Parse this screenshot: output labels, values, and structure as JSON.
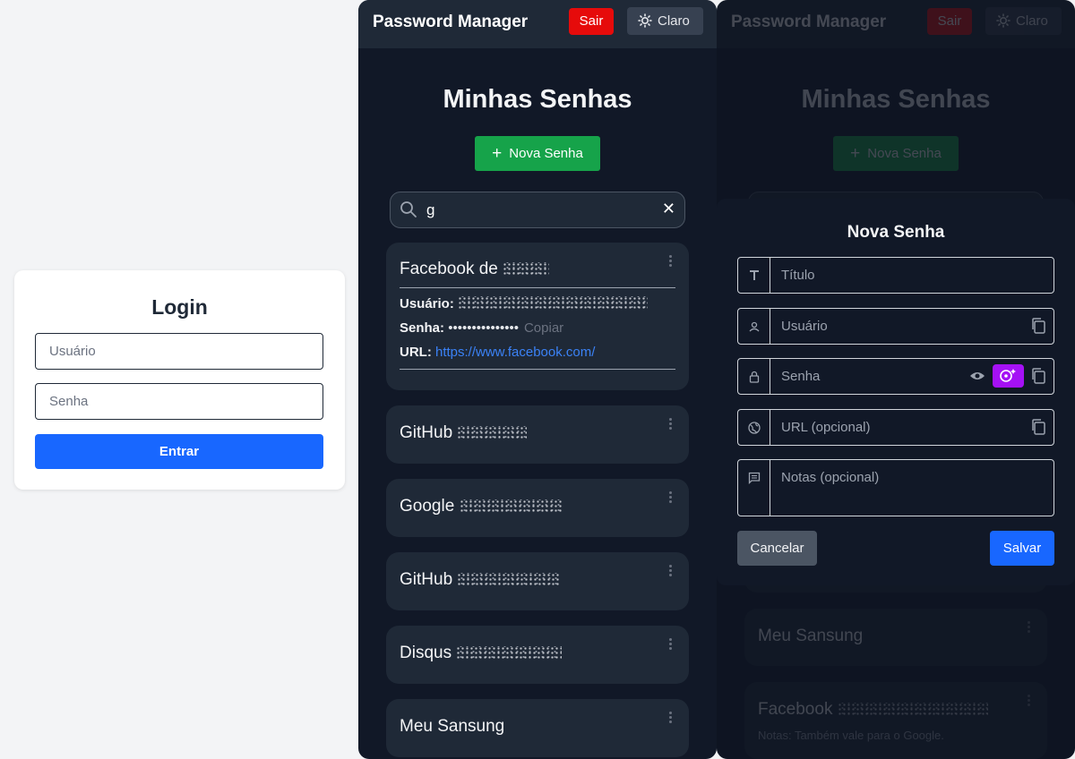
{
  "login": {
    "title": "Login",
    "username_placeholder": "Usuário",
    "password_placeholder": "Senha",
    "submit_label": "Entrar"
  },
  "header": {
    "title": "Password Manager",
    "logout_label": "Sair",
    "theme_label": "Claro"
  },
  "main": {
    "title": "Minhas Senhas",
    "new_button_label": "Nova Senha",
    "search_value": "g",
    "clear_icon": "✕"
  },
  "cards": [
    {
      "title": "Facebook de",
      "expanded": true,
      "user_label": "Usuário:",
      "password_label": "Senha:",
      "password_mask": "•••••••••••••••",
      "copy_label": "Copiar",
      "url_label": "URL:",
      "url": "https://www.facebook.com/"
    },
    {
      "title": "GitHub"
    },
    {
      "title": "Google"
    },
    {
      "title": "GitHub"
    },
    {
      "title": "Disqus"
    },
    {
      "title": "Meu Sansung"
    }
  ],
  "bg_cards": [
    {
      "title": "Meu Sansung"
    },
    {
      "title": "Facebook",
      "notes": "Notas: Também vale para o Google."
    }
  ],
  "modal": {
    "title": "Nova Senha",
    "title_placeholder": "Título",
    "user_placeholder": "Usuário",
    "password_placeholder": "Senha",
    "url_placeholder": "URL (opcional)",
    "notes_placeholder": "Notas (opcional)",
    "cancel_label": "Cancelar",
    "save_label": "Salvar"
  },
  "colors": {
    "primary": "#1867ff",
    "danger": "#e60b0b",
    "success": "#16a34a",
    "generate": "#a511f5",
    "link": "#3b82f6"
  }
}
